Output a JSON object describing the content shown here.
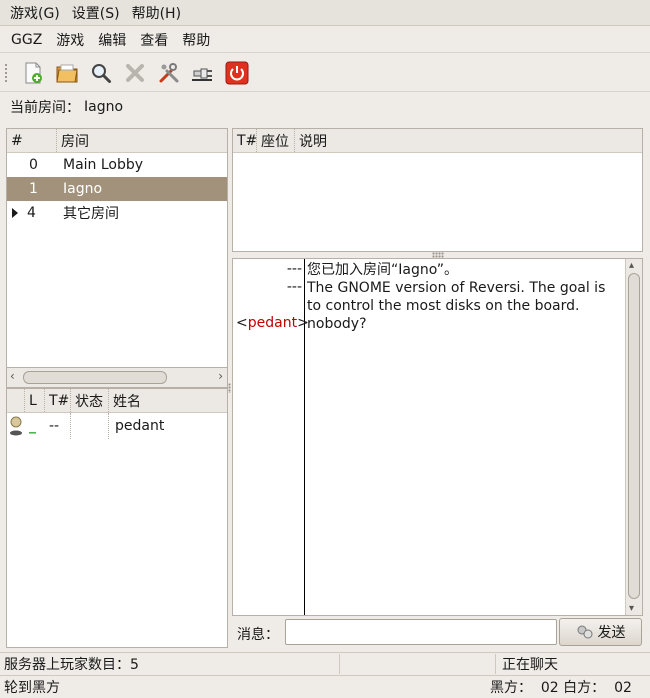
{
  "app_menu": [
    "游戏(G)",
    "设置(S)",
    "帮助(H)"
  ],
  "menu": [
    "GGZ",
    "游戏",
    "编辑",
    "查看",
    "帮助"
  ],
  "toolbar_icons": [
    "new-game-icon",
    "open-folder-icon",
    "search-icon",
    "delete-icon",
    "tools-icon",
    "connect-plug-icon",
    "power-icon"
  ],
  "current_room": {
    "label": "当前房间：",
    "value": "Iagno"
  },
  "room_list": {
    "headers": [
      "#",
      "房间"
    ],
    "rows": [
      {
        "num": "0",
        "name": "Main Lobby",
        "selected": false,
        "expandable": false
      },
      {
        "num": "1",
        "name": "Iagno",
        "selected": true,
        "expandable": false
      },
      {
        "num": "4",
        "name": "其它房间",
        "selected": false,
        "expandable": true
      }
    ]
  },
  "player_list": {
    "headers": [
      "L",
      "T#",
      "状态",
      "姓名"
    ],
    "rows": [
      {
        "lag": "_",
        "table": "--",
        "status": "",
        "name": "pedant"
      }
    ]
  },
  "table_list": {
    "headers": [
      "T#",
      "座位",
      "说明"
    ]
  },
  "chat": [
    {
      "nick": "---",
      "text": "您已加入房间“Iagno”。",
      "nick_is_user": false
    },
    {
      "nick": "---",
      "text": "The GNOME version of Reversi. The goal is to control the most disks on the board.",
      "nick_is_user": false
    },
    {
      "nick_prefix": "<",
      "nick": "pedant",
      "nick_suffix": ">",
      "text": "nobody?",
      "nick_is_user": true
    }
  ],
  "message": {
    "label": "消息：",
    "value": "",
    "send_label": "发送"
  },
  "status": {
    "players": "服务器上玩家数目：5",
    "middle": "",
    "state": "正在聊天",
    "turn": "轮到黑方",
    "score": "黑方：  02 白方：  02"
  },
  "colors": {
    "selected_row": "#a3927b",
    "nick_red": "#c00000",
    "lag_green": "#2ea52e"
  }
}
